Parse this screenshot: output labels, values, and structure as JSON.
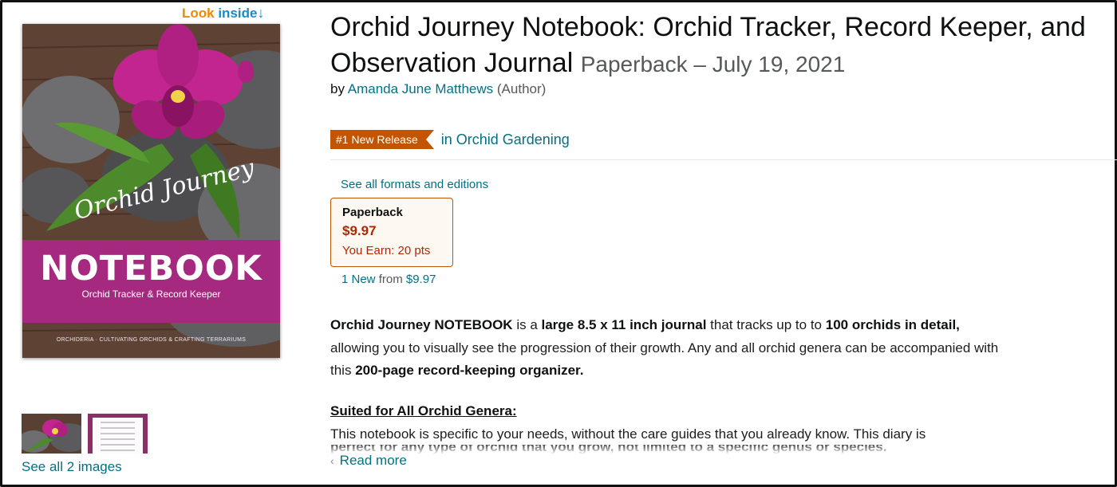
{
  "look_inside": {
    "look": "Look",
    "inside": " inside",
    "arrow": "↓"
  },
  "cover": {
    "script_title": "Orchid Journey",
    "big_title": "NOTEBOOK",
    "subtitle": "Orchid Tracker & Record Keeper",
    "credit": "ORCHIDERIA · CULTIVATING ORCHIDS & CRAFTING TERRARIUMS"
  },
  "gallery": {
    "see_all": "See all 2 images"
  },
  "product": {
    "title": "Orchid Journey Notebook: Orchid Tracker, Record Keeper, and Observation Journal",
    "format_date": "Paperback – July 19, 2021",
    "by": "by",
    "author": "Amanda June Matthews",
    "author_role": "(Author)"
  },
  "badge": {
    "label": "#1 New Release",
    "category": "in Orchid Gardening"
  },
  "formats": {
    "see_all": "See all formats and editions",
    "selected": {
      "name": "Paperback",
      "price": "$9.97",
      "earn": "You Earn: 20 pts"
    },
    "new_count": "1 New",
    "new_from": "from",
    "new_price": "$9.97"
  },
  "description": {
    "p1": [
      {
        "b": true,
        "t": "Orchid Journey NOTEBOOK"
      },
      {
        "b": false,
        "t": " is a "
      },
      {
        "b": true,
        "t": "large 8.5 x 11 inch journal"
      },
      {
        "b": false,
        "t": " that tracks up to to "
      },
      {
        "b": true,
        "t": "100 orchids in detail,"
      },
      {
        "b": false,
        "t": " allowing you to visually see the progression of their growth. Any and all orchid genera can be accompanied with this "
      },
      {
        "b": true,
        "t": "200-page record-keeping organizer."
      }
    ],
    "heading": "Suited for All Orchid Genera:",
    "p2": "This notebook is specific to your needs, without the care guides that you already know. This diary is",
    "p2_cut": "perfect for any type of orchid that you grow, not limited to a specific genus or species.",
    "read_more": "Read more"
  }
}
